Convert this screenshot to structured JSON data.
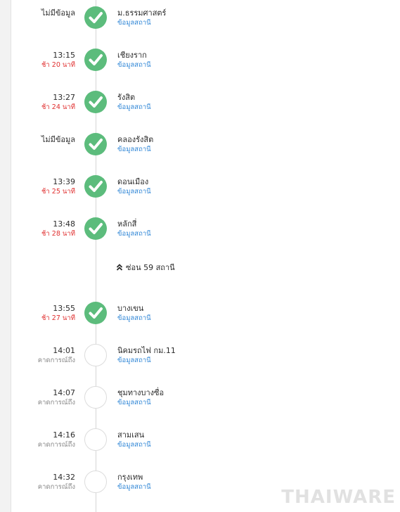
{
  "timeline": {
    "stops": [
      {
        "time": "ไม่มีข้อมูล",
        "sub": "",
        "sub_type": "none",
        "status": "done",
        "name": "ม.ธรรมศาสตร์",
        "link": "ข้อมูลสถานี"
      },
      {
        "time": "13:15",
        "sub": "ช้า 20 นาที",
        "sub_type": "delay",
        "status": "done",
        "name": "เชียงราก",
        "link": "ข้อมูลสถานี"
      },
      {
        "time": "13:27",
        "sub": "ช้า 24 นาที",
        "sub_type": "delay",
        "status": "done",
        "name": "รังสิต",
        "link": "ข้อมูลสถานี"
      },
      {
        "time": "ไม่มีข้อมูล",
        "sub": "",
        "sub_type": "none",
        "status": "done",
        "name": "คลองรังสิต",
        "link": "ข้อมูลสถานี"
      },
      {
        "time": "13:39",
        "sub": "ช้า 25 นาที",
        "sub_type": "delay",
        "status": "done",
        "name": "ดอนเมือง",
        "link": "ข้อมูลสถานี"
      },
      {
        "time": "13:48",
        "sub": "ช้า 28 นาที",
        "sub_type": "delay",
        "status": "done",
        "name": "หลักสี่",
        "link": "ข้อมูลสถานี"
      },
      {
        "time": "13:55",
        "sub": "ช้า 27 นาที",
        "sub_type": "delay",
        "status": "done",
        "name": "บางเขน",
        "link": "ข้อมูลสถานี"
      },
      {
        "time": "14:01",
        "sub": "คาดการณ์ถึง",
        "sub_type": "expected",
        "status": "pending",
        "name": "นิคมรถไฟ กม.11",
        "link": "ข้อมูลสถานี"
      },
      {
        "time": "14:07",
        "sub": "คาดการณ์ถึง",
        "sub_type": "expected",
        "status": "pending",
        "name": "ชุมทางบางซื่อ",
        "link": "ข้อมูลสถานี"
      },
      {
        "time": "14:16",
        "sub": "คาดการณ์ถึง",
        "sub_type": "expected",
        "status": "pending",
        "name": "สามเสน",
        "link": "ข้อมูลสถานี"
      },
      {
        "time": "14:32",
        "sub": "คาดการณ์ถึง",
        "sub_type": "expected",
        "status": "pending",
        "name": "กรุงเทพ",
        "link": "ข้อมูลสถานี"
      }
    ],
    "hidden_toggle_label": "ซ่อน 59 สถานี"
  },
  "watermark": "THAIWARE",
  "colors": {
    "done": "#5cbc7c",
    "delay": "#e03030",
    "link": "#2f86d6",
    "expected": "#8a8a8a"
  }
}
